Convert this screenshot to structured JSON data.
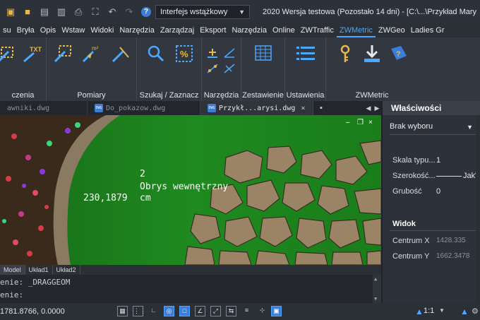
{
  "titlebar": {
    "workspace": "Interfejs wstążkowy",
    "title": "2020 Wersja testowa (Pozostało 14 dni) - [C:\\...\\Przykład Mary"
  },
  "menu": [
    "su",
    "Bryła",
    "Opis",
    "Wstaw",
    "Widoki",
    "Narzędzia",
    "Zarządzaj",
    "Eksport",
    "Narzędzia",
    "Online",
    "ZWTraffic",
    "ZWMetric",
    "ZWGeo",
    "Ladies Gr"
  ],
  "ribbon": {
    "groups": [
      "czenia",
      "Pomiary",
      "Szukaj / Zaznacz",
      "Narzędzia",
      "Zestawienie",
      "Ustawienia",
      "ZWMetric"
    ]
  },
  "doctabs": [
    "awniki.dwg",
    "Do_pokazow.dwg",
    "Przykł...arysi.dwg"
  ],
  "drawing": {
    "label_num": "2",
    "label_name": "Obrys wewnętrzny",
    "label_value": "230,1879",
    "label_unit": "cm"
  },
  "layouttabs": [
    "Model",
    "Układ1",
    "Układ2"
  ],
  "cmd": {
    "line1": "enie: _DRAGGEOM",
    "line2": "enie:"
  },
  "status": {
    "coords": "1781.8766, 0.0000",
    "scale": "1:1"
  },
  "props": {
    "title": "Właściwości",
    "selection": "Brak wyboru",
    "rows": [
      {
        "label": "Skala typu...",
        "value": "1"
      },
      {
        "label": "Szerokość...",
        "value": "JakWa"
      },
      {
        "label": "Grubość",
        "value": "0"
      }
    ],
    "section_view": "Widok",
    "view_rows": [
      {
        "label": "Centrum X",
        "value": "1428.335"
      },
      {
        "label": "Centrum Y",
        "value": "1662.3478"
      }
    ]
  },
  "colors": {
    "accent": "#4aa8ff",
    "lawn": "#1f8a1f",
    "stone": "#9b8466"
  }
}
